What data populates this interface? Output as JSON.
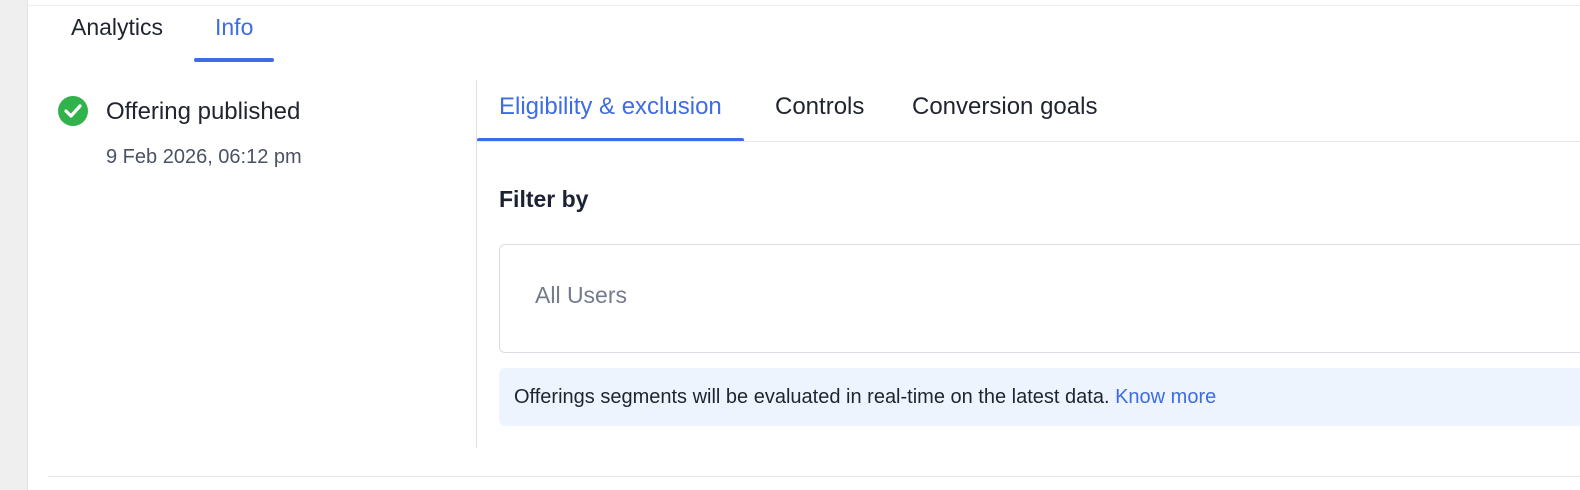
{
  "top_tabs": [
    {
      "label": "Analytics",
      "active": false
    },
    {
      "label": "Info",
      "active": true
    }
  ],
  "status": {
    "icon": "check-circle-icon",
    "title": "Offering published",
    "timestamp": "9 Feb 2026, 06:12 pm"
  },
  "sub_tabs": [
    {
      "label": "Eligibility & exclusion",
      "active": true
    },
    {
      "label": "Controls",
      "active": false
    },
    {
      "label": "Conversion goals",
      "active": false
    }
  ],
  "filter": {
    "label": "Filter by",
    "value": "All Users"
  },
  "info_banner": {
    "text": "Offerings segments will be evaluated in real-time on the latest data. ",
    "link": "Know more"
  },
  "colors": {
    "accent": "#3d6ce3",
    "success": "#2fb34a",
    "banner_bg": "#eef4fd"
  }
}
